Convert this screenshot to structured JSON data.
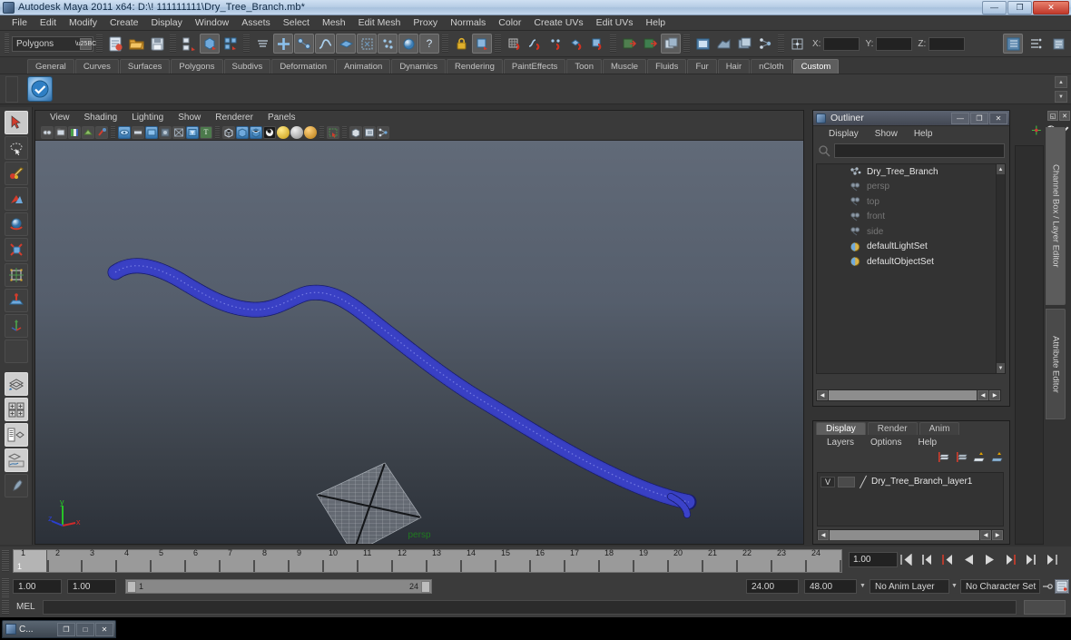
{
  "window": {
    "title": "Autodesk Maya 2011 x64: D:\\! 111111111\\Dry_Tree_Branch.mb*",
    "icon": "maya-app-icon",
    "minimize": "—",
    "maximize": "❐",
    "close": "✕"
  },
  "menubar": {
    "items": [
      "File",
      "Edit",
      "Modify",
      "Create",
      "Display",
      "Window",
      "Assets",
      "Select",
      "Mesh",
      "Edit Mesh",
      "Proxy",
      "Normals",
      "Color",
      "Create UVs",
      "Edit UVs",
      "Help"
    ]
  },
  "toolbar": {
    "mode_selector": "Polygons",
    "x_label": "X:",
    "y_label": "Y:",
    "z_label": "Z:",
    "x_value": "",
    "y_value": "",
    "z_value": "",
    "buttons": [
      {
        "name": "new-scene-icon",
        "glyph": "⎘"
      },
      {
        "name": "open-scene-icon",
        "glyph": "📁"
      },
      {
        "name": "save-scene-icon",
        "glyph": "💾"
      },
      {
        "name": "select-by-hierarchy-icon",
        "glyph": "◰"
      },
      {
        "name": "select-by-object-type-icon",
        "glyph": "▣"
      },
      {
        "name": "select-by-component-type-icon",
        "glyph": "▦"
      },
      {
        "name": "select-mask-icon",
        "glyph": "≡"
      },
      {
        "name": "handles-icon",
        "glyph": "✚"
      },
      {
        "name": "joints-icon",
        "glyph": "⎇"
      },
      {
        "name": "curves-icon",
        "glyph": "∿"
      },
      {
        "name": "surfaces-icon",
        "glyph": "◆"
      },
      {
        "name": "deformations-icon",
        "glyph": "▧"
      },
      {
        "name": "dynamics-icon",
        "glyph": "∴"
      },
      {
        "name": "rendering-icon",
        "glyph": "●"
      },
      {
        "name": "misc-icon",
        "glyph": "?"
      },
      {
        "name": "lock-icon",
        "glyph": "🔒"
      },
      {
        "name": "highlight-icon",
        "glyph": "▣"
      },
      {
        "name": "snap-to-grid-icon",
        "glyph": "⊞"
      },
      {
        "name": "snap-to-curve-icon",
        "glyph": "∿"
      },
      {
        "name": "snap-to-point-icon",
        "glyph": "∴"
      },
      {
        "name": "snap-to-projected-center-icon",
        "glyph": "⊙"
      },
      {
        "name": "snap-to-view-plane-icon",
        "glyph": "◧"
      },
      {
        "name": "construction-history-in-icon",
        "glyph": "⇥"
      },
      {
        "name": "construction-history-out-icon",
        "glyph": "⇤"
      },
      {
        "name": "construction-history-toggle-icon",
        "glyph": "⧉"
      },
      {
        "name": "render-current-frame-icon",
        "glyph": "🎬"
      },
      {
        "name": "ipr-render-icon",
        "glyph": "◳"
      },
      {
        "name": "render-settings-icon",
        "glyph": "⚙"
      },
      {
        "name": "hypershade-icon",
        "glyph": "⁂"
      },
      {
        "name": "show-hide-channel-box-icon",
        "glyph": "▤"
      },
      {
        "name": "show-hide-attribute-editor-icon",
        "glyph": "⋮"
      },
      {
        "name": "show-hide-tool-settings-icon",
        "glyph": "✎"
      }
    ]
  },
  "shelf": {
    "tabs": [
      "General",
      "Curves",
      "Surfaces",
      "Polygons",
      "Subdivs",
      "Deformation",
      "Animation",
      "Dynamics",
      "Rendering",
      "PaintEffects",
      "Toon",
      "Muscle",
      "Fluids",
      "Fur",
      "Hair",
      "nCloth",
      "Custom"
    ],
    "active_tab": "Custom",
    "items": [
      {
        "name": "check-shelf-icon",
        "glyph": "✔"
      }
    ]
  },
  "toolbox": {
    "tools": [
      {
        "name": "select-tool",
        "glyph": "➤",
        "state": "active"
      },
      {
        "name": "lasso-tool",
        "glyph": "◌",
        "state": "normal"
      },
      {
        "name": "paint-selection-tool",
        "glyph": "✒",
        "state": "normal"
      },
      {
        "name": "move-tool",
        "glyph": "✥",
        "state": "normal"
      },
      {
        "name": "rotate-tool",
        "glyph": "↻",
        "state": "normal"
      },
      {
        "name": "scale-tool",
        "glyph": "⬜",
        "state": "normal"
      },
      {
        "name": "universal-manipulator-tool",
        "glyph": "⬡",
        "state": "normal"
      },
      {
        "name": "soft-modification-tool",
        "glyph": "⬤",
        "state": "normal"
      },
      {
        "name": "show-manipulator-tool",
        "glyph": "✣",
        "state": "normal"
      },
      {
        "name": "last-tool-used",
        "glyph": "",
        "state": "empty"
      },
      {
        "name": "single-perspective-view-layout",
        "glyph": "◇",
        "state": "light"
      },
      {
        "name": "four-view-layout",
        "glyph": "⊞",
        "state": "light"
      },
      {
        "name": "outliner-persp-layout",
        "glyph": "▤",
        "state": "light"
      },
      {
        "name": "hypergraph-persp-layout",
        "glyph": "▨",
        "state": "light"
      },
      {
        "name": "paint-effects-layout",
        "glyph": "⍟",
        "state": "normal"
      }
    ]
  },
  "viewport": {
    "menus": [
      "View",
      "Shading",
      "Lighting",
      "Show",
      "Renderer",
      "Panels"
    ],
    "camera_label": "persp",
    "axis": {
      "x": "x",
      "y": "y",
      "z": "z"
    },
    "icons": [
      {
        "name": "select-camera-icon",
        "glyph": "◎"
      },
      {
        "name": "bookmark-icon",
        "glyph": "▥"
      },
      {
        "name": "image-plane-icon",
        "glyph": "▤"
      },
      {
        "name": "two-sided-lighting-icon",
        "glyph": "◑"
      },
      {
        "name": "no-lights-icon",
        "glyph": "✶"
      },
      {
        "name": "grid-toggle-icon",
        "glyph": "⌗"
      },
      {
        "name": "film-gate-icon",
        "glyph": "▭"
      },
      {
        "name": "resolution-gate-icon",
        "glyph": "▢"
      },
      {
        "name": "field-chart-icon",
        "glyph": "⊞"
      },
      {
        "name": "safe-action-icon",
        "glyph": "▣"
      },
      {
        "name": "safe-title-icon",
        "glyph": "T"
      },
      {
        "name": "wireframe-shading-icon",
        "glyph": "□"
      },
      {
        "name": "smooth-shade-all-icon",
        "glyph": "■"
      },
      {
        "name": "smooth-shade-textured-icon",
        "glyph": "▣"
      },
      {
        "name": "use-all-lights-icon",
        "glyph": "⚽"
      },
      {
        "name": "shadows-icon",
        "glyph": "●"
      },
      {
        "name": "xray-icon",
        "glyph": "○"
      },
      {
        "name": "xray-joints-icon",
        "glyph": "●"
      },
      {
        "name": "isolate-select-icon",
        "glyph": "⬚"
      },
      {
        "name": "ipr-region-icon",
        "glyph": "⬜"
      },
      {
        "name": "render-region-icon",
        "glyph": "⧉"
      },
      {
        "name": "exposure-icon",
        "glyph": "⋈"
      }
    ]
  },
  "outliner": {
    "title": "Outliner",
    "menus": [
      "Display",
      "Show",
      "Help"
    ],
    "search_value": "",
    "window_buttons": {
      "minimize": "—",
      "maximize": "❐",
      "close": "✕"
    },
    "nodes": [
      {
        "label": "Dry_Tree_Branch",
        "icon": "mesh-node-icon",
        "dim": false
      },
      {
        "label": "persp",
        "icon": "camera-node-icon",
        "dim": true
      },
      {
        "label": "top",
        "icon": "camera-node-icon",
        "dim": true
      },
      {
        "label": "front",
        "icon": "camera-node-icon",
        "dim": true
      },
      {
        "label": "side",
        "icon": "camera-node-icon",
        "dim": true
      },
      {
        "label": "defaultLightSet",
        "icon": "set-node-icon",
        "dim": false
      },
      {
        "label": "defaultObjectSet",
        "icon": "set-node-icon",
        "dim": false
      }
    ]
  },
  "layer_editor": {
    "tabs": [
      "Display",
      "Render",
      "Anim"
    ],
    "active_tab": "Display",
    "menus": [
      "Layers",
      "Options",
      "Help"
    ],
    "toolbar_icons": [
      {
        "name": "new-empty-layer-icon"
      },
      {
        "name": "new-layer-from-selected-icon"
      },
      {
        "name": "move-layer-up-icon"
      },
      {
        "name": "move-layer-down-icon"
      }
    ],
    "layers": [
      {
        "visibility": "V",
        "playback": "",
        "name": "Dry_Tree_Branch_layer1"
      }
    ]
  },
  "right_tabs": {
    "items": [
      "Channel Box / Layer Editor",
      "Attribute Editor"
    ],
    "active": "Channel Box / Layer Editor",
    "buttons": [
      {
        "name": "undock-icon",
        "glyph": "◱"
      },
      {
        "name": "close-panel-icon",
        "glyph": "✕"
      }
    ]
  },
  "time_slider": {
    "ticks": [
      "1",
      "2",
      "3",
      "4",
      "5",
      "6",
      "7",
      "8",
      "9",
      "10",
      "11",
      "12",
      "13",
      "14",
      "15",
      "16",
      "17",
      "18",
      "19",
      "20",
      "21",
      "22",
      "23",
      "24"
    ],
    "current_frame": "1",
    "current_frame_field": "1.00",
    "playback_buttons": [
      {
        "name": "go-to-start-button",
        "glyph": "⏮"
      },
      {
        "name": "step-back-key-button",
        "glyph": "⏴|"
      },
      {
        "name": "step-back-frame-button",
        "glyph": "|◀"
      },
      {
        "name": "play-backwards-button",
        "glyph": "◀"
      },
      {
        "name": "play-forwards-button",
        "glyph": "▶"
      },
      {
        "name": "step-forward-frame-button",
        "glyph": "▶|"
      },
      {
        "name": "step-forward-key-button",
        "glyph": "▶|"
      },
      {
        "name": "go-to-end-button",
        "glyph": "⏭"
      }
    ]
  },
  "range_slider": {
    "start_field": "1.00",
    "range_start_field": "1.00",
    "range_min_label": "1",
    "range_max_label": "24",
    "range_end_field": "24.00",
    "end_field": "48.00",
    "anim_layer": "No Anim Layer",
    "character_set": "No Character Set",
    "auto_key_icon": "auto-keyframe-icon",
    "animation_prefs_icon": "animation-preferences-icon"
  },
  "command_line": {
    "label": "MEL",
    "value": ""
  },
  "taskbar": {
    "title": "C...",
    "buttons": {
      "restore": "❐",
      "maximize": "□",
      "close": "✕"
    }
  }
}
